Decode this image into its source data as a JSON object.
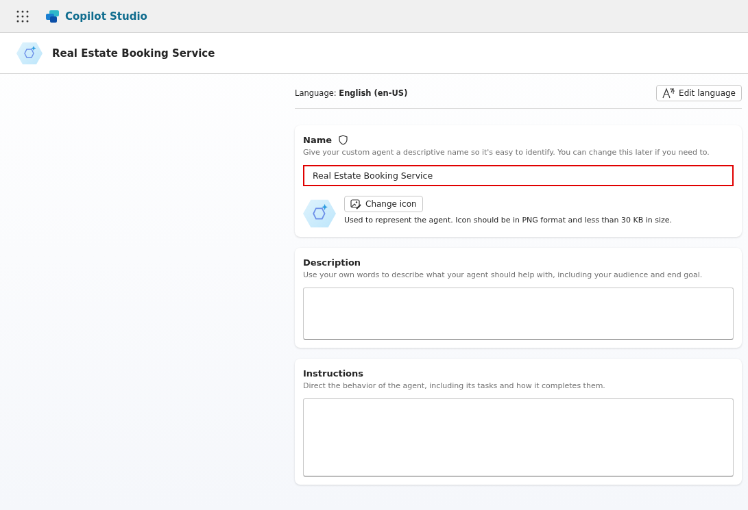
{
  "app": {
    "title": "Copilot Studio"
  },
  "agent_header": {
    "title": "Real Estate Booking Service"
  },
  "language": {
    "text": "Language: **English (en-US)**",
    "button": "Edit language"
  },
  "name_section": {
    "title": "Name",
    "hint": "Give your custom agent a descriptive name so it's easy to identify. You can change this later if you need to.",
    "value": "Real Estate Booking Service",
    "highlighted": true,
    "icon_button": "Change icon",
    "icon_hint": "Used to represent the agent. Icon should be in PNG format and less than 30 KB in size."
  },
  "sections": [
    {
      "title": "Description",
      "hint": "Use your own words to describe what your agent should help with, including your audience and end goal."
    },
    {
      "title": "Instructions",
      "hint": "Direct the behavior of the agent, including its tasks and how it completes them."
    }
  ]
}
